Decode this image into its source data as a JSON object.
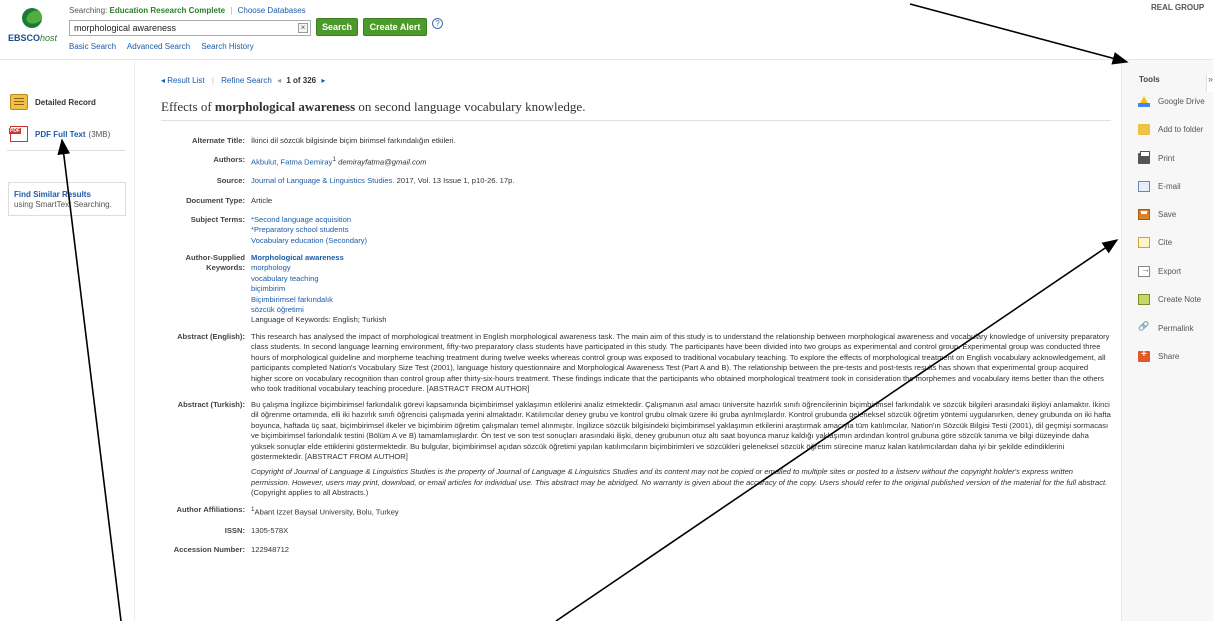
{
  "header": {
    "logo_text": "EBSCO",
    "logo_host": "host",
    "searching_label": "Searching:",
    "database": "Education Research Complete",
    "choose_databases": "Choose Databases",
    "search_query": "morphological awareness",
    "clear_label": "×",
    "search_button": "Search",
    "create_alert_button": "Create Alert",
    "help_label": "?",
    "links": [
      "Basic Search",
      "Advanced Search",
      "Search History"
    ],
    "account": "REAL GROUP"
  },
  "left": {
    "detailed_record": "Detailed Record",
    "pdf_full_text": "PDF Full Text",
    "pdf_size": "(3MB)",
    "find_similar": "Find Similar Results",
    "find_similar_sub": "using SmartText Searching."
  },
  "nav": {
    "result_list": "◂ Result List",
    "refine_search": "Refine Search",
    "prev": "◂",
    "position": "1 of 326",
    "next": "▸"
  },
  "article": {
    "title_pre": "Effects of ",
    "title_bold": "morphological awareness",
    "title_post": " on second language vocabulary knowledge.",
    "fields": {
      "alternate_title_label": "Alternate Title:",
      "alternate_title": "İkinci dil sözcük bilgisinde biçim birimsel farkındalığın etkileri.",
      "authors_label": "Authors:",
      "author_name": "Akbulut, Fatma Demiray",
      "author_sup": "1",
      "author_email": " demirayfatma@gmail.com",
      "source_label": "Source:",
      "source_journal": "Journal of Language & Linguistics Studies.",
      "source_detail": " 2017, Vol. 13 Issue 1, p10-26. 17p.",
      "doc_type_label": "Document Type:",
      "doc_type": "Article",
      "subject_terms_label": "Subject Terms:",
      "subject_terms": [
        "*Second language acquisition",
        "*Preparatory school students",
        "Vocabulary education (Secondary)"
      ],
      "keywords_label": "Author-Supplied Keywords:",
      "keywords": [
        "Morphological awareness",
        "morphology",
        "vocabulary teaching",
        "biçimbirim",
        "Biçimbirimsel farkındalık",
        "sözcük öğretimi"
      ],
      "keywords_language": "Language of Keywords: English; Turkish",
      "abstract_en_label": "Abstract (English):",
      "abstract_en": "This research has analysed the impact of morphological treatment in English morphological awareness task. The main aim of this study is to understand the relationship between morphological awareness and vocabulary knowledge of university preparatory class students. In second language learning environment, fifty-two preparatory class students have participated in this study. The participants have been divided into two groups as experimental and control group. Experimental group was conducted three hours of morphological guideline and morpheme teaching treatment during twelve weeks whereas control group was exposed to traditional vocabulary teaching. To explore the effects of morphological treatment on English vocabulary acknowledgement, all participants completed Nation's Vocabulary Size Test (2001), language history questionnaire and Morphological Awareness Test (Part A and B). The relationship between the pre-tests and post-tests results has shown that experimental group acquired higher score on vocabulary recognition than control group after thirty-six-hours treatment. These findings indicate that the participants who obtained morphological treatment took in consideration the morphemes and vocabulary items better than the others who took traditional vocabulary teaching procedure. [ABSTRACT FROM AUTHOR]",
      "abstract_tr_label": "Abstract (Turkish):",
      "abstract_tr": "Bu çalışma İngilizce biçimbirimsel farkındalık görevi kapsamında biçimbirimsel yaklaşımın etkilerini analiz etmektedir. Çalışmanın asıl amacı üniversite hazırlık sınıfı öğrencilerinin biçimbirimsel farkındalık ve sözcük bilgileri arasındaki ilişkiyi anlamaktır. İkinci dil öğrenme ortamında, elli iki hazırlık sınıfı öğrencisi çalışmada yerini almaktadır. Katılımcılar deney grubu ve kontrol grubu olmak üzere iki gruba ayrılmışlardır. Kontrol grubunda geleneksel sözcük öğretim yöntemi uygulanırken, deney grubunda on iki hafta boyunca, haftada üç saat, biçimbirimsel ilkeler ve biçimbirim öğretim çalışmaları temel alınmıştır. İngilizce sözcük bilgisindeki biçimbirimsel yaklaşımın etkilerini araştırmak amacıyla tüm katılımcılar, Nation'ın Sözcük Bilgisi Testi (2001), dil geçmişi sormacası ve biçimbirimsel farkındalık testini (Bölüm A ve B) tamamlamışlardır. Ön test ve son test sonuçları arasındaki ilişki, deney grubunun otuz altı saat boyunca maruz kaldığı yaklaşımın ardından kontrol grubuna göre sözcük tanıma ve bilgi düzeyinde daha yüksek sonuçlar elde ettiklerini göstermektedir. Bu bulgular, biçimbirimsel açıdan sözcük öğretimi yapılan katılımcıların biçimbirimleri ve sözcükleri geleneksel sözcük öğretim sürecine maruz kalan katılımcılardan daha iyi bir şekilde edindiklerini göstermektedir. [ABSTRACT FROM AUTHOR]",
      "copyright": "Copyright of Journal of Language & Linguistics Studies is the property of Journal of Language & Linguistics Studies and its content may not be copied or emailed to multiple sites or posted to a listserv without the copyright holder's express written permission. However, users may print, download, or email articles for individual use. This abstract may be abridged. No warranty is given about the accuracy of the copy. Users should refer to the original published version of the material for the full abstract.",
      "copyright_tail": " (Copyright applies to all Abstracts.)",
      "affiliations_label": "Author Affiliations:",
      "affiliation_sup": "1",
      "affiliation": "Abant Izzet Baysal University, Bolu, Turkey",
      "issn_label": "ISSN:",
      "issn": "1305-578X",
      "accession_label": "Accession Number:",
      "accession": "122948712"
    }
  },
  "tools": {
    "title": "Tools",
    "collapse": "»",
    "items": [
      "Google Drive",
      "Add to folder",
      "Print",
      "E-mail",
      "Save",
      "Cite",
      "Export",
      "Create Note",
      "Permalink",
      "Share"
    ]
  }
}
